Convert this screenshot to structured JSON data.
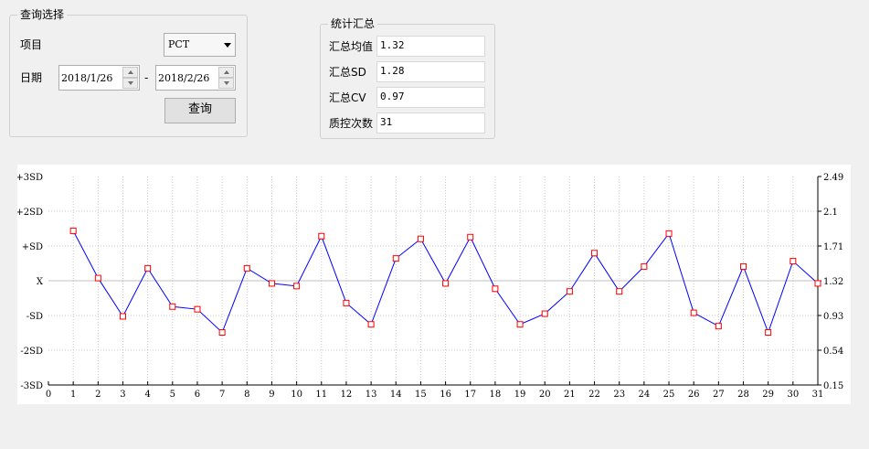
{
  "query_panel": {
    "title": "查询选择",
    "item_label": "项目",
    "item_value": "PCT",
    "date_label": "日期",
    "date_from": "2018/1/26",
    "date_separator": "-",
    "date_to": "2018/2/26",
    "query_button": "查询"
  },
  "stats_panel": {
    "title": "统计汇总",
    "rows": [
      {
        "label": "汇总均值",
        "value": "1.32"
      },
      {
        "label": "汇总SD",
        "value": "1.28"
      },
      {
        "label": "汇总CV",
        "value": "0.97"
      },
      {
        "label": "质控次数",
        "value": "31"
      }
    ]
  },
  "chart_data": {
    "type": "line",
    "x_ticks": [
      "0",
      "1",
      "2",
      "3",
      "4",
      "5",
      "6",
      "7",
      "8",
      "9",
      "10",
      "11",
      "12",
      "13",
      "14",
      "15",
      "16",
      "17",
      "18",
      "19",
      "20",
      "21",
      "22",
      "23",
      "24",
      "25",
      "26",
      "27",
      "28",
      "29",
      "30",
      "31"
    ],
    "xlim": [
      0,
      31
    ],
    "left_ticks": [
      "+3SD",
      "+2SD",
      "+SD",
      "X",
      "-SD",
      "-2SD",
      "-3SD"
    ],
    "right_ticks": [
      "2.49",
      "2.1",
      "1.71",
      "1.32",
      "0.93",
      "0.54",
      "0.15"
    ],
    "ylim": [
      0.15,
      2.49
    ],
    "grid": true,
    "line_color": "#0000ff",
    "marker_color": "#ff0000",
    "mean_line_color": "#c0c0c0",
    "x": [
      1,
      2,
      3,
      4,
      5,
      6,
      7,
      8,
      9,
      10,
      11,
      12,
      13,
      14,
      15,
      16,
      17,
      18,
      19,
      20,
      21,
      22,
      23,
      24,
      25,
      26,
      27,
      28,
      29,
      30,
      31
    ],
    "values": [
      1.88,
      1.35,
      0.92,
      1.46,
      1.03,
      1.0,
      0.74,
      1.46,
      1.29,
      1.26,
      1.82,
      1.07,
      0.83,
      1.57,
      1.79,
      1.29,
      1.81,
      1.23,
      0.83,
      0.95,
      1.2,
      1.63,
      1.2,
      1.48,
      1.85,
      0.96,
      0.81,
      1.48,
      0.74,
      1.54,
      1.29
    ]
  }
}
